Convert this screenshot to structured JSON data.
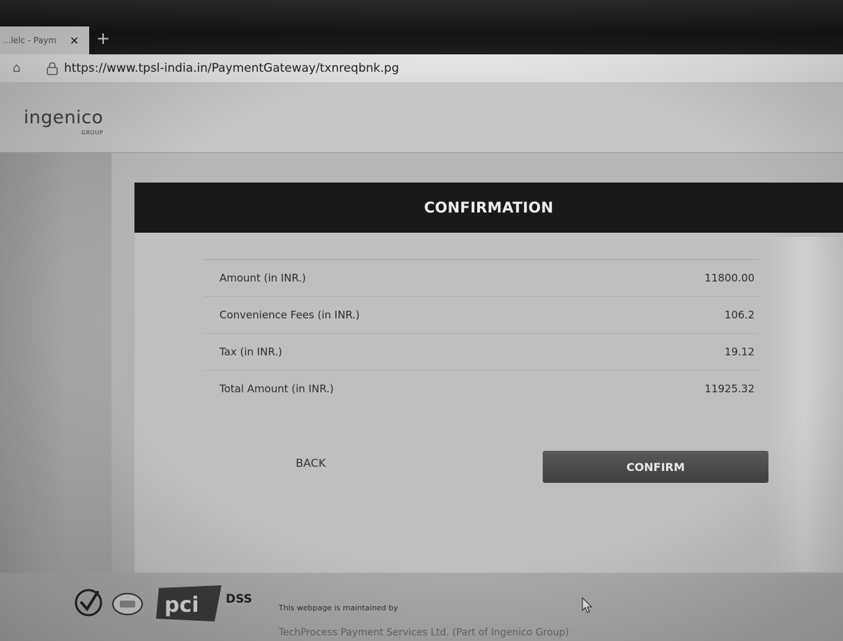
{
  "browser": {
    "tab_title": "...lelc - Paym",
    "tab_close": "✕",
    "new_tab": "+",
    "url": "https://www.tpsl-india.in/PaymentGateway/txnreqbnk.pg"
  },
  "header": {
    "logo_text": "ingenico",
    "logo_sub": "GROUP"
  },
  "confirmation": {
    "title": "CONFIRMATION",
    "rows": [
      {
        "label": "Amount (in INR.)",
        "value": "11800.00"
      },
      {
        "label": "Convenience Fees (in INR.)",
        "value": "106.2"
      },
      {
        "label": "Tax (in INR.)",
        "value": "19.12"
      },
      {
        "label": "Total Amount (in INR.)",
        "value": "11925.32"
      }
    ],
    "back_label": "BACK",
    "confirm_label": "CONFIRM"
  },
  "footer": {
    "dss_label": "DSS",
    "maintained_by": "This webpage is maintained by",
    "company": "TechProcess Payment Services Ltd. (Part of Ingenico Group)"
  }
}
